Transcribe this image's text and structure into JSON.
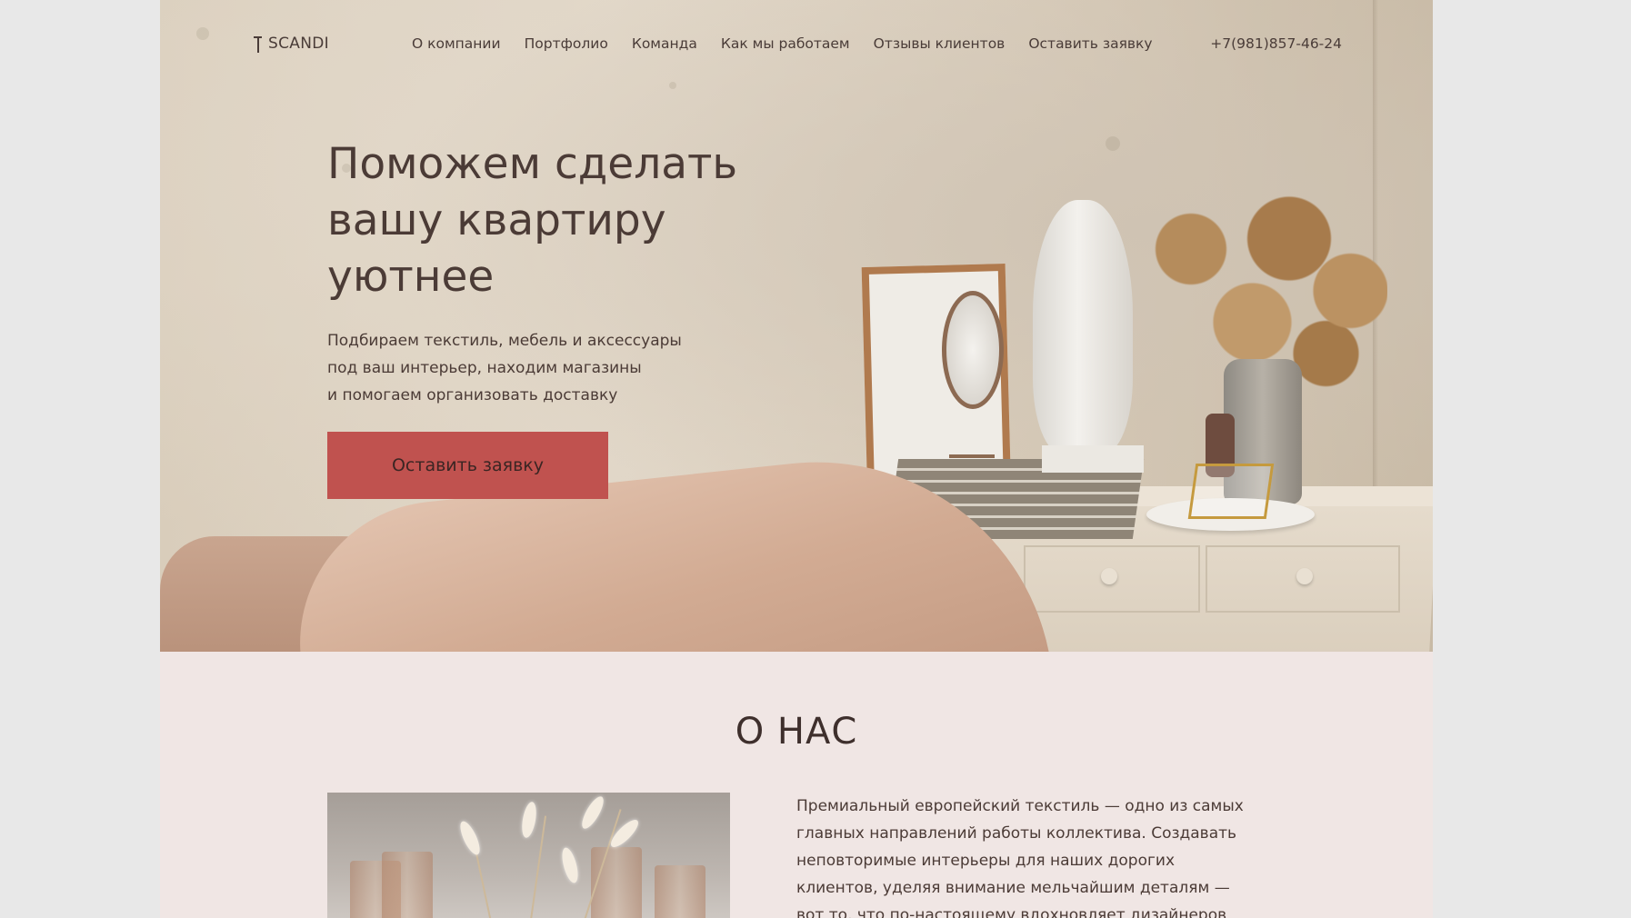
{
  "header": {
    "logo_text": "SCANDI",
    "nav": [
      {
        "label": "О компании"
      },
      {
        "label": "Портфолио"
      },
      {
        "label": "Команда"
      },
      {
        "label": "Как мы работаем"
      },
      {
        "label": "Отзывы клиентов"
      },
      {
        "label": "Оставить заявку"
      }
    ],
    "phone": "+7(981)857-46-24"
  },
  "hero": {
    "headline_lines": [
      "Поможем сделать",
      "вашу квартиру",
      "уютнее"
    ],
    "subtext_lines": [
      "Подбираем текстиль, мебель и аксессуары",
      "под ваш интерьер, находим магазины",
      "и помогаем организовать доставку"
    ],
    "cta_label": "Оставить заявку"
  },
  "about": {
    "title": "О НАС",
    "text_lines": [
      "Премиальный европейский текстиль — одно из самых",
      "главных направлений работы коллектива. Создавать",
      "неповторимые интерьеры для наших дорогих",
      "клиентов, уделяя внимание мельчайшим деталям —",
      "вот то, что по-настоящему вдохновляет дизайнеров"
    ]
  },
  "colors": {
    "accent": "#c0524f",
    "text": "#4b3b36",
    "about_bg": "#f0e6e4",
    "page_bg": "#e8e8e8"
  }
}
